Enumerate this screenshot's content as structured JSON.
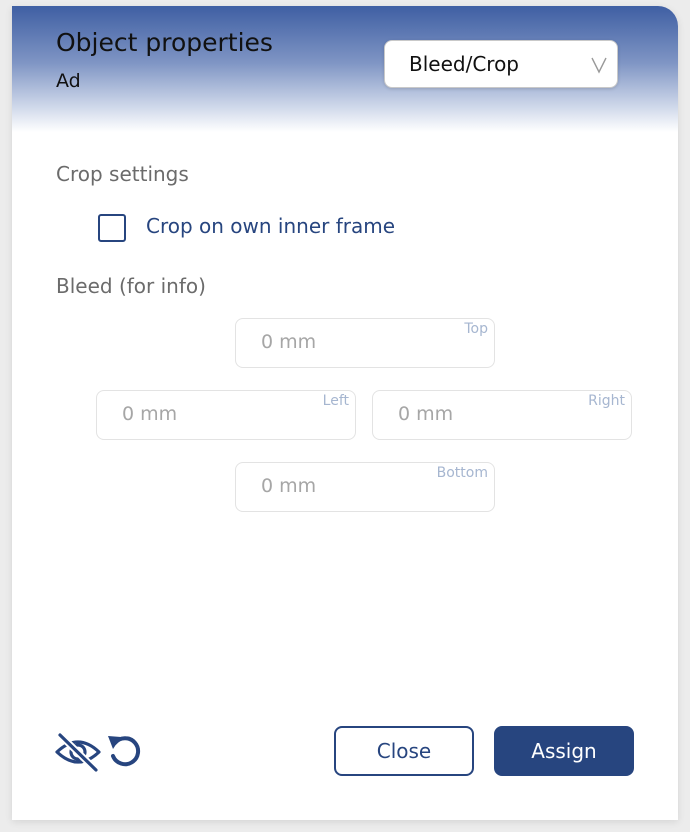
{
  "header": {
    "title": "Object properties",
    "subtitle": "Ad",
    "view_select": {
      "value": "Bleed/Crop"
    }
  },
  "crop": {
    "section_label": "Crop settings",
    "checkbox_label": "Crop on own inner frame",
    "checked": false
  },
  "bleed": {
    "section_label": "Bleed (for info)",
    "top": {
      "value": "0 mm",
      "tag": "Top"
    },
    "left": {
      "value": "0 mm",
      "tag": "Left"
    },
    "right": {
      "value": "0 mm",
      "tag": "Right"
    },
    "bottom": {
      "value": "0 mm",
      "tag": "Bottom"
    }
  },
  "footer": {
    "close_label": "Close",
    "assign_label": "Assign",
    "icons": [
      "eye-slash-icon",
      "reset-icon"
    ]
  },
  "colors": {
    "primary": "#27457f",
    "header_top": "#3f5fa3",
    "muted_text": "#6b6b6b",
    "placeholder": "#a6a6a6",
    "tag": "#a6b6d0"
  }
}
